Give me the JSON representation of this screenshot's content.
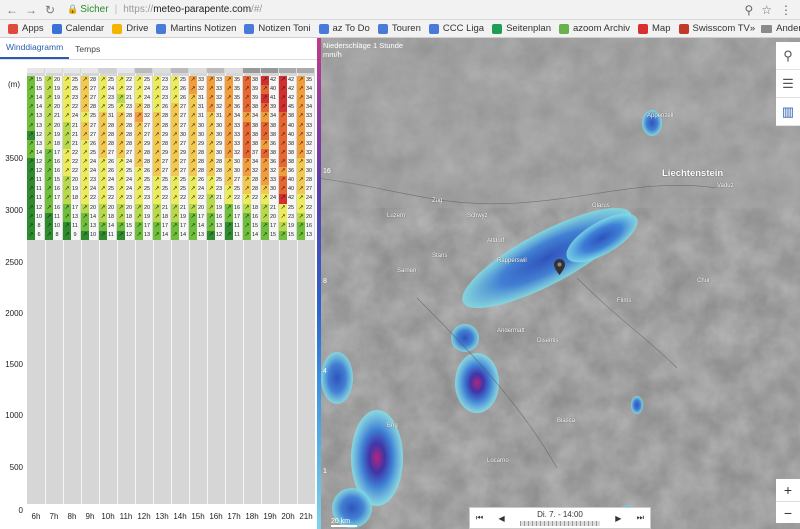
{
  "browser": {
    "secure_label": "Sicher",
    "url_proto": "https://",
    "url_host": "meteo-parapente.com",
    "url_path": "/#/",
    "bookmarks": [
      {
        "label": "Apps",
        "color": "#e04a3a"
      },
      {
        "label": "Calendar",
        "color": "#3b6fd9"
      },
      {
        "label": "Drive",
        "color": "#f4b400"
      },
      {
        "label": "Martins Notizen",
        "color": "#4a7ad9"
      },
      {
        "label": "Notizen Toni",
        "color": "#4a7ad9"
      },
      {
        "label": "az To Do",
        "color": "#4a7ad9"
      },
      {
        "label": "Touren",
        "color": "#4a7ad9"
      },
      {
        "label": "CCC Liga",
        "color": "#4a7ad9"
      },
      {
        "label": "Seitenplan",
        "color": "#1f9d55"
      },
      {
        "label": "azoom Archiv",
        "color": "#6ab04c"
      },
      {
        "label": "Map",
        "color": "#d63031"
      },
      {
        "label": "Swisscom TV",
        "color": "#c0392b"
      }
    ],
    "more_label": "»",
    "other_bookmarks": "Andere Lesezeichen"
  },
  "left_panel": {
    "tabs": [
      {
        "label": "Winddiagramm",
        "active": true
      },
      {
        "label": "Temps",
        "active": false
      }
    ],
    "y_unit": "(m)",
    "y_ticks": [
      "3500",
      "3000",
      "2500",
      "2000",
      "1500",
      "1000",
      "500",
      "0"
    ],
    "x_ticks": [
      "6h",
      "7h",
      "8h",
      "9h",
      "10h",
      "11h",
      "12h",
      "13h",
      "14h",
      "15h",
      "16h",
      "17h",
      "18h",
      "19h",
      "20h",
      "21h"
    ],
    "wind_rows": [
      [
        "15",
        "20",
        "25",
        "28",
        "25",
        "22",
        "25",
        "23",
        "25",
        "33",
        "33",
        "35",
        "38",
        "42",
        "42",
        "35"
      ],
      [
        "15",
        "19",
        "25",
        "27",
        "24",
        "22",
        "24",
        "23",
        "26",
        "32",
        "33",
        "35",
        "39",
        "40",
        "42",
        "34"
      ],
      [
        "14",
        "19",
        "23",
        "27",
        "23",
        "21",
        "24",
        "23",
        "26",
        "31",
        "32",
        "35",
        "39",
        "41",
        "42",
        "34"
      ],
      [
        "14",
        "20",
        "22",
        "28",
        "25",
        "23",
        "28",
        "26",
        "27",
        "31",
        "32",
        "36",
        "38",
        "39",
        "45",
        "34"
      ],
      [
        "13",
        "21",
        "24",
        "25",
        "31",
        "28",
        "32",
        "28",
        "27",
        "31",
        "31",
        "34",
        "34",
        "34",
        "38",
        "33"
      ],
      [
        "13",
        "20",
        "21",
        "27",
        "28",
        "28",
        "27",
        "28",
        "27",
        "30",
        "30",
        "33",
        "38",
        "38",
        "40",
        "33"
      ],
      [
        "12",
        "19",
        "21",
        "27",
        "28",
        "28",
        "27",
        "29",
        "30",
        "30",
        "30",
        "33",
        "38",
        "38",
        "40",
        "32"
      ],
      [
        "13",
        "18",
        "21",
        "26",
        "28",
        "28",
        "29",
        "28",
        "27",
        "29",
        "29",
        "33",
        "38",
        "36",
        "38",
        "32"
      ],
      [
        "14",
        "17",
        "22",
        "25",
        "27",
        "27",
        "28",
        "29",
        "29",
        "28",
        "30",
        "32",
        "37",
        "38",
        "38",
        "32"
      ],
      [
        "12",
        "16",
        "22",
        "24",
        "26",
        "24",
        "28",
        "27",
        "27",
        "28",
        "28",
        "30",
        "34",
        "36",
        "38",
        "30"
      ],
      [
        "12",
        "16",
        "22",
        "24",
        "26",
        "25",
        "26",
        "27",
        "27",
        "28",
        "28",
        "30",
        "32",
        "32",
        "36",
        "30"
      ],
      [
        "11",
        "15",
        "20",
        "23",
        "24",
        "24",
        "25",
        "25",
        "25",
        "26",
        "25",
        "27",
        "28",
        "33",
        "40",
        "28"
      ],
      [
        "11",
        "16",
        "19",
        "24",
        "25",
        "24",
        "25",
        "25",
        "25",
        "24",
        "23",
        "25",
        "28",
        "30",
        "40",
        "27"
      ],
      [
        "11",
        "17",
        "18",
        "22",
        "22",
        "23",
        "23",
        "22",
        "22",
        "22",
        "21",
        "22",
        "22",
        "24",
        "42",
        "24"
      ],
      [
        "12",
        "16",
        "17",
        "20",
        "20",
        "20",
        "20",
        "21",
        "21",
        "20",
        "19",
        "16",
        "18",
        "21",
        "25",
        "22"
      ],
      [
        "10",
        "11",
        "13",
        "14",
        "18",
        "18",
        "19",
        "18",
        "19",
        "17",
        "16",
        "17",
        "16",
        "20",
        "23",
        "20"
      ],
      [
        "8",
        "10",
        "11",
        "13",
        "14",
        "15",
        "17",
        "17",
        "17",
        "14",
        "13",
        "11",
        "15",
        "17",
        "19",
        "16"
      ],
      [
        "6",
        "8",
        "9",
        "10",
        "11",
        "12",
        "13",
        "14",
        "14",
        "13",
        "12",
        "11",
        "14",
        "15",
        "15",
        "13"
      ]
    ]
  },
  "map": {
    "legend_title": "Niederschläge 1 Stunde",
    "legend_unit": "mm/h",
    "legend_ticks": [
      "16",
      "8",
      "4",
      "1"
    ],
    "places": [
      "Liechtenstein",
      "Rapperswil",
      "Glarus",
      "Appenzell",
      "Vaduz",
      "Zug",
      "Schwyz",
      "Altdorf",
      "Luzern",
      "Sarnen",
      "Stans",
      "Chur",
      "Flims",
      "Disentis",
      "Andermatt",
      "Biasca",
      "Locarno",
      "Lugano",
      "Brig"
    ],
    "time_label": "Di. 7. - 14:00",
    "scale_label": "20 km",
    "zoom_in": "+",
    "zoom_out": "−"
  }
}
